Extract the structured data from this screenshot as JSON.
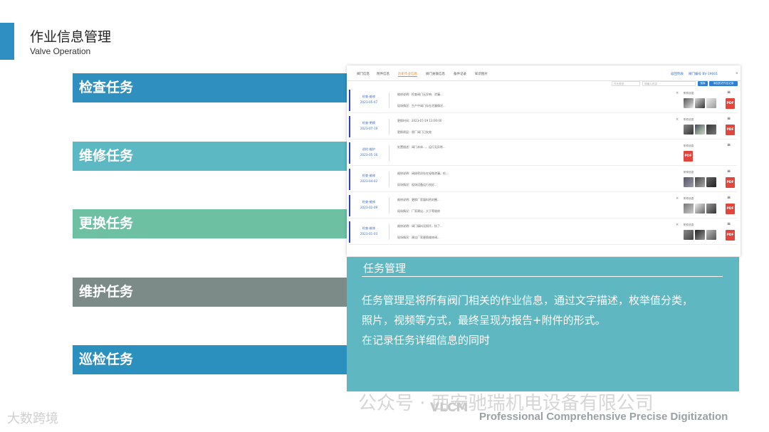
{
  "header": {
    "title": "作业信息管理",
    "subtitle": "Valve Operation",
    "accent_color": "#2f8fc3"
  },
  "task_list": [
    {
      "label": "检查任务",
      "color": "#2f8fbf"
    },
    {
      "label": "维修任务",
      "color": "#5cb8c2"
    },
    {
      "label": "更换任务",
      "color": "#6ec0a3"
    },
    {
      "label": "维护任务",
      "color": "#7d8b88"
    },
    {
      "label": "巡检任务",
      "color": "#2c90bf"
    }
  ],
  "screenshot": {
    "tabs": [
      "阀门信息",
      "附件信息",
      "历史作业信息",
      "阀门关联信息",
      "备件记录",
      "知识图片"
    ],
    "active_tab": "历史作业信息",
    "right_links": [
      "返回列表",
      "阀门编号 BV-19001"
    ],
    "toolbar": {
      "select_placeholder": "作业类型",
      "search_placeholder": "请输入内容",
      "search_button": "搜索",
      "add_button": "添加历史作业记录"
    },
    "rows": [
      {
        "status": "检查-维修",
        "date": "2023-05-07",
        "line1": "维修说明：检查阀门无异响、泄漏...",
        "line2": "现场情况：生产中阀门存在泄漏情况...",
        "attachment_label": "附件信息",
        "thumbs": 3
      },
      {
        "status": "检查-更换",
        "date": "2023-07-19",
        "line1": "更换时间：2023-07-19 13:00:00",
        "line2": "更换原因：原厂阀门已失效",
        "attachment_label": "附件信息",
        "thumbs": 3
      },
      {
        "status": "巡检-维护",
        "date": "2023-05-16",
        "line1": "处置描述：阀门本体...，运行无异常...",
        "line2": "",
        "attachment_label": "附件信息",
        "thumbs": 0
      },
      {
        "status": "检查-维修",
        "date": "2023-04-02",
        "line1": "维修说明：阀体密封存在轻微渗漏，检...",
        "line2": "现场情况：现场设备运行良好...",
        "attachment_label": "附件信息",
        "thumbs": 3
      },
      {
        "status": "检查-维修",
        "date": "2023-02-09",
        "line1": "维修说明：更换厂家填料密封圈...",
        "line2": "现场情况：厂家建议，大于等维修",
        "attachment_label": "附件信息",
        "thumbs": 3
      },
      {
        "status": "检查-维修",
        "date": "2023-01-03",
        "line1": "维修说明：阀门填料无损坏，执了...",
        "line2": "现场情况：建议厂家更换维修阀...",
        "attachment_label": "附件信息",
        "thumbs": 3
      }
    ],
    "pdf_label": "PDF"
  },
  "description": {
    "title": "任务管理",
    "lines": [
      "任务管理是将所有阀门相关的作业信息，通过文字描述，枚举值分类，",
      "照片，视频等方式，最终呈现为报告+附件的形式。",
      "在记录任务详细信息的同时"
    ]
  },
  "footer": {
    "watermark_left": "大数跨境",
    "watermark_brand": "公众号 · 西安驰瑞机电设备有限公司",
    "vlcm": "VLCM",
    "tagline": "Professional  Comprehensive  Precise  Digitization"
  }
}
